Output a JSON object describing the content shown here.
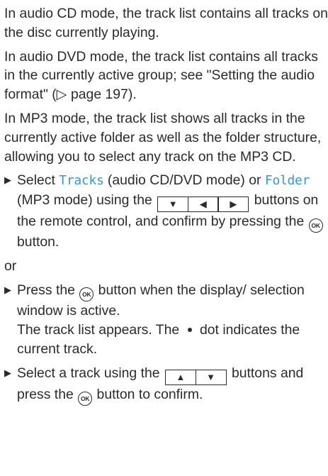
{
  "para1": "In audio CD mode, the track list contains all tracks on the disc currently playing.",
  "para2": "In audio DVD mode, the track list contains all tracks in the currently active group; see \"Set­ting the audio format\" (▷ page 197).",
  "para3": "In MP3 mode, the track list shows all tracks in the currently active folder as well as the folder structure, allowing you to select any track on the MP3 CD.",
  "step1": {
    "bullet": "▶",
    "pre": "Select ",
    "kw1": "Tracks",
    "mid1": " (audio CD/DVD mode) or ",
    "kw2": "Folder",
    "mid2": " (MP3 mode) using the ",
    "keys": [
      "▼",
      "◀",
      "▶"
    ],
    "post": " buttons on the remote control, and confirm by pressing the ",
    "ok": "OK",
    "end": " button."
  },
  "or": "or",
  "step2": {
    "bullet": "▶",
    "pre": "Press the ",
    "ok": "OK",
    "post": " button when the display/ selection window is active.",
    "result_pre": "The track list appears. The ",
    "result_post": " dot indicates the current track."
  },
  "step3": {
    "bullet": "▶",
    "pre": "Select a track using the ",
    "keys": [
      "▲",
      "▼"
    ],
    "mid": " buttons and press the ",
    "ok": "OK",
    "end": " button to confirm."
  },
  "icons": [
    "bullet-triangle-icon",
    "ok-button-icon",
    "down-arrow-key-icon",
    "left-arrow-key-icon",
    "right-arrow-key-icon",
    "up-arrow-key-icon",
    "current-track-dot-icon"
  ],
  "colors": {
    "text": "#2b2b2b",
    "keyword": "#2f9ad6"
  }
}
